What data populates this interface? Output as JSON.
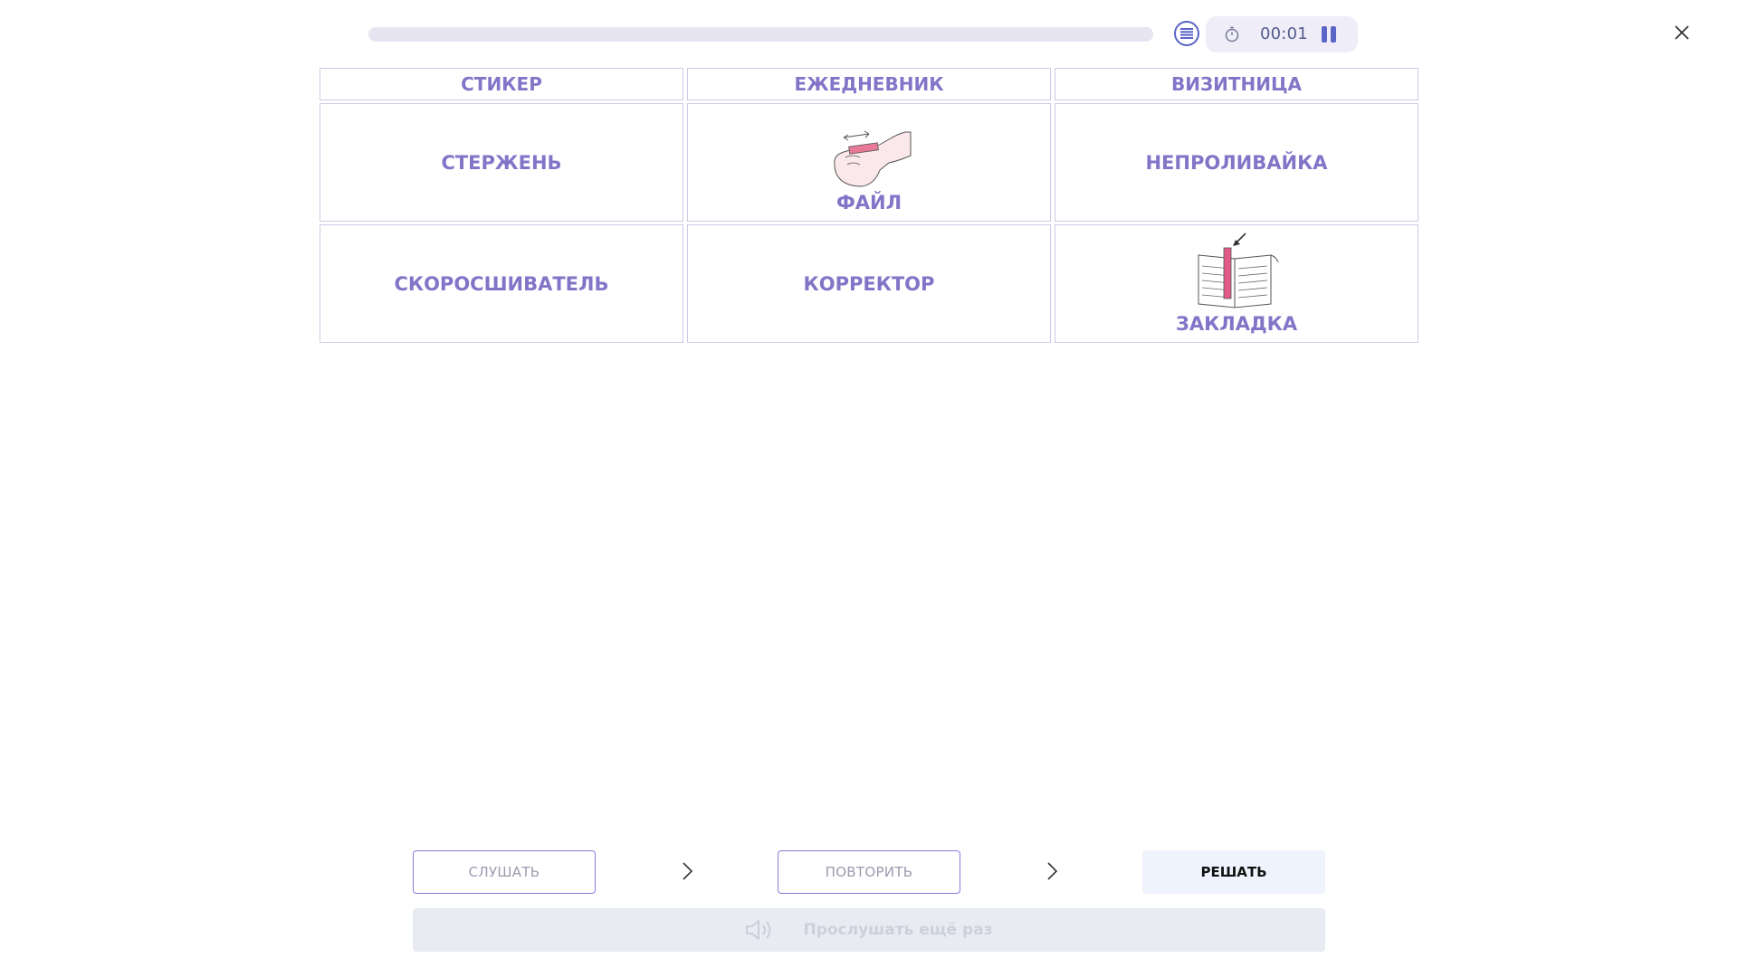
{
  "topbar": {
    "progress": 0,
    "menu_icon": "list-icon",
    "timer_icon": "stopwatch-icon",
    "timer": "00:01",
    "pause_icon": "pause-icon",
    "close_icon": "close-icon"
  },
  "grid": {
    "headers": [
      "СТИКЕР",
      "ЕЖЕДНЕВНИК",
      "ВИЗИТНИЦА"
    ],
    "rows": [
      [
        {
          "label": "СТЕРЖЕНЬ",
          "icon": ""
        },
        {
          "label": "ФАЙЛ",
          "icon": "hand-pulling-tape-icon"
        },
        {
          "label": "НЕПРОЛИВАЙКА",
          "icon": ""
        }
      ],
      [
        {
          "label": "СКОРОСШИВАТЕЛЬ",
          "icon": ""
        },
        {
          "label": "КОРРЕКТОР",
          "icon": ""
        },
        {
          "label": "ЗАКЛАДКА",
          "icon": "book-bookmark-icon"
        }
      ]
    ]
  },
  "bottom": {
    "listen_label": "СЛУШАТЬ",
    "repeat_label": "ПОВТОРИТЬ",
    "solve_label": "РЕШАТЬ",
    "arrow_icon": "chevron-right-icon",
    "listen_again_label": "Прослушать ещё раз",
    "listen_again_icon": "speaker-icon"
  },
  "colors": {
    "accent": "#8474c8",
    "primary": "#5b64c7",
    "border": "#cfcbe6",
    "solve_bg": "#eef3fd"
  }
}
